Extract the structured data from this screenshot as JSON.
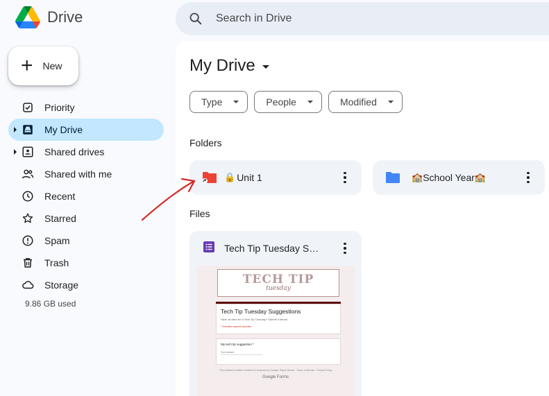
{
  "app": {
    "name": "Drive"
  },
  "search": {
    "placeholder": "Search in Drive"
  },
  "new_button": {
    "label": "New"
  },
  "sidebar": {
    "items": [
      {
        "label": "Priority",
        "icon": "priority-icon",
        "active": false
      },
      {
        "label": "My Drive",
        "icon": "my-drive-icon",
        "active": true
      },
      {
        "label": "Shared drives",
        "icon": "shared-drives-icon",
        "active": false
      },
      {
        "label": "Shared with me",
        "icon": "shared-with-me-icon",
        "active": false
      },
      {
        "label": "Recent",
        "icon": "clock-icon",
        "active": false
      },
      {
        "label": "Starred",
        "icon": "star-icon",
        "active": false
      },
      {
        "label": "Spam",
        "icon": "spam-icon",
        "active": false
      },
      {
        "label": "Trash",
        "icon": "trash-icon",
        "active": false
      },
      {
        "label": "Storage",
        "icon": "cloud-icon",
        "active": false
      }
    ],
    "storage_used": "9.86 GB used"
  },
  "main": {
    "title": "My Drive",
    "filters": {
      "type": "Type",
      "people": "People",
      "modified": "Modified"
    },
    "folders_label": "Folders",
    "files_label": "Files",
    "folders": [
      {
        "name": "Unit 1",
        "color": "#ea4335",
        "prefix_emoji": "🔒"
      },
      {
        "name": "School Year",
        "color": "#4285f4",
        "prefix_emoji": "🏫",
        "suffix_emoji": "🏫"
      }
    ],
    "files": [
      {
        "name": "Tech Tip Tuesday Suggestions",
        "icon": "forms-icon",
        "preview": {
          "banner_title": "TECH TIP",
          "banner_subtitle": "tuesday",
          "form_title": "Tech Tip Tuesday Suggestions",
          "form_desc": "Have an idea for a Tech Tip Tuesday? Submit it below!",
          "form_required": "* Indicates required question",
          "question": "My tech tip suggestion *",
          "answer_placeholder": "Your answer",
          "footer_note": "This content is neither created nor endorsed by Google. Report Abuse - Terms of Service - Privacy Policy",
          "brand": "Google Forms"
        }
      }
    ]
  },
  "colors": {
    "accent": "#c2e7ff",
    "annotation_arrow": "#d62828"
  }
}
